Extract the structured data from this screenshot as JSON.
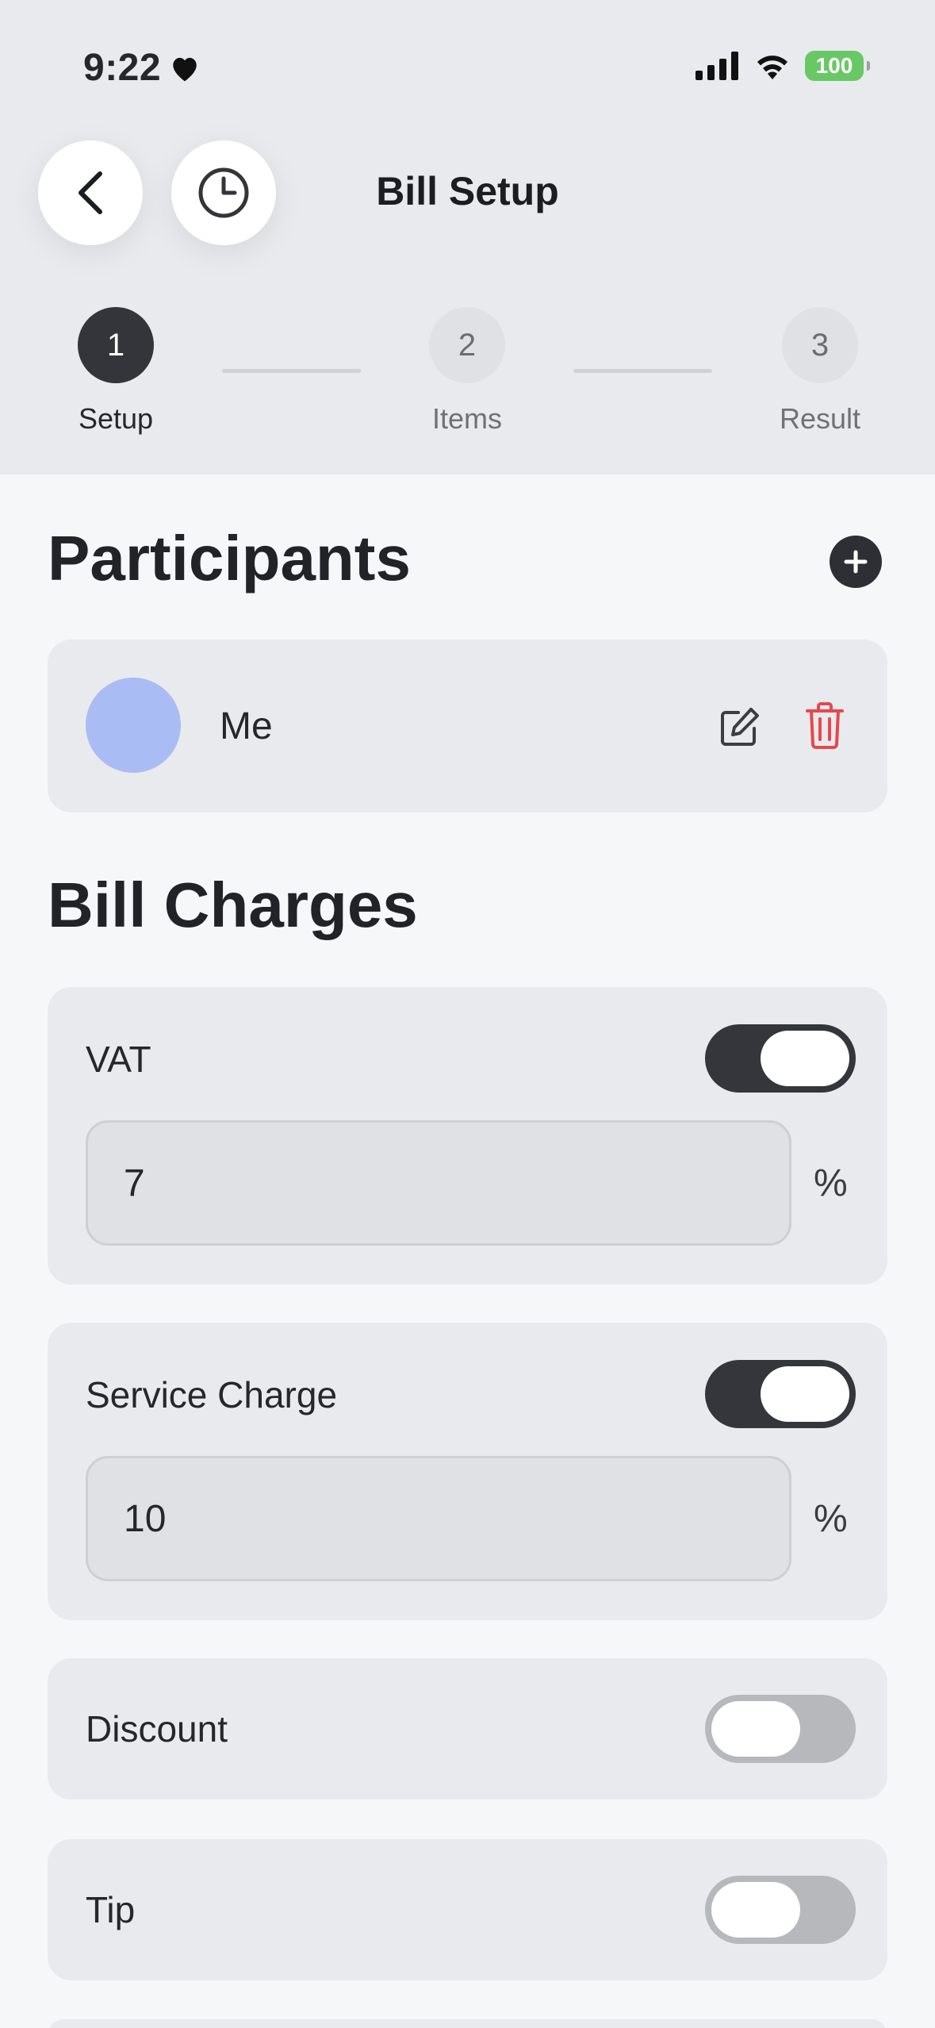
{
  "status_bar": {
    "time": "9:22",
    "battery": "100"
  },
  "header": {
    "title": "Bill Setup"
  },
  "stepper": {
    "steps": [
      {
        "number": "1",
        "label": "Setup",
        "state": "active"
      },
      {
        "number": "2",
        "label": "Items",
        "state": "inactive"
      },
      {
        "number": "3",
        "label": "Result",
        "state": "inactive"
      }
    ]
  },
  "participants": {
    "title": "Participants",
    "items": [
      {
        "name": "Me",
        "avatar_color": "#aabcf4"
      }
    ]
  },
  "charges": {
    "title": "Bill Charges",
    "vat": {
      "label": "VAT",
      "enabled": true,
      "value": "7",
      "unit": "%"
    },
    "service": {
      "label": "Service Charge",
      "enabled": true,
      "value": "10",
      "unit": "%"
    },
    "discount": {
      "label": "Discount",
      "enabled": false
    },
    "tip": {
      "label": "Tip",
      "enabled": false
    }
  },
  "colors": {
    "accent_dark": "#33353a",
    "delete_red": "#e5484d",
    "battery_green": "#68c865"
  }
}
